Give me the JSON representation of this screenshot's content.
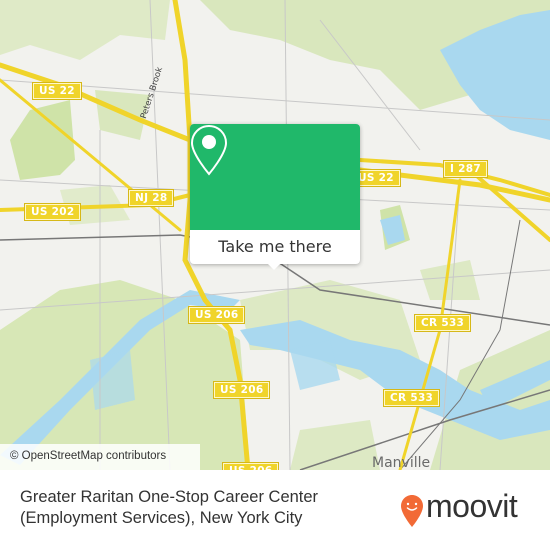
{
  "map": {
    "road_shields": [
      {
        "label": "US 22",
        "id": "us22-west"
      },
      {
        "label": "US 22",
        "id": "us22-east"
      },
      {
        "label": "I 287",
        "id": "i287"
      },
      {
        "label": "NJ 28",
        "id": "nj28"
      },
      {
        "label": "US 202",
        "id": "us202"
      },
      {
        "label": "US 206",
        "id": "us206-north"
      },
      {
        "label": "US 206",
        "id": "us206-middle"
      },
      {
        "label": "US 206",
        "id": "us206-south"
      },
      {
        "label": "CR 533",
        "id": "cr533-north"
      },
      {
        "label": "CR 533",
        "id": "cr533-south"
      }
    ],
    "place_labels": {
      "manville": "Manville",
      "peters_brook": "Peters Brook"
    },
    "attribution": "© OpenStreetMap contributors",
    "colors": {
      "land": "#f2f2ee",
      "park": "#cfe3a8",
      "water": "#a9d8ef",
      "highway": "#f0d42a"
    }
  },
  "popup": {
    "icon": "location-pin-icon",
    "button_label": "Take me there",
    "color": "#20b86a"
  },
  "footer": {
    "title_line1": "Greater Raritan One-Stop Career Center",
    "title_line2": "(Employment Services), New York City",
    "logo_text": "moovit",
    "logo_color": "#f26a36"
  }
}
